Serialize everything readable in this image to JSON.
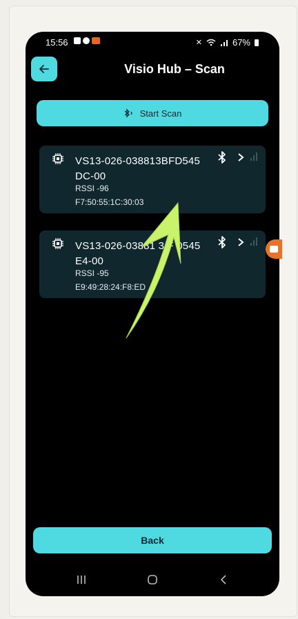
{
  "status_bar": {
    "time": "15:56",
    "battery": "67%"
  },
  "header": {
    "title": "Visio Hub – Scan"
  },
  "scan_button": {
    "label": "Start Scan"
  },
  "devices": [
    {
      "name": "VS13-026-038813BFD545",
      "name_line2": "DC-00",
      "rssi": "RSSI -96",
      "mac": "F7:50:55:1C:30:03"
    },
    {
      "name": "VS13-026-03881 3 F 0545",
      "name_line2": "E4-00",
      "rssi": "RSSI -95",
      "mac": "E9:49:28:24:F8:ED"
    }
  ],
  "bottom_button": {
    "label": "Back"
  },
  "colors": {
    "accent": "#4fd9e0",
    "card": "#10282d",
    "annotation_arrow": "#c9f36a",
    "record_indicator": "#e6732a"
  },
  "icons": {
    "back": "arrow-left-icon",
    "scan": "bluetooth-searching-icon",
    "device": "chip-icon",
    "bluetooth": "bluetooth-icon",
    "chevron": "chevron-right-icon",
    "nav": [
      "recent-apps-icon",
      "home-icon",
      "back-icon"
    ]
  }
}
